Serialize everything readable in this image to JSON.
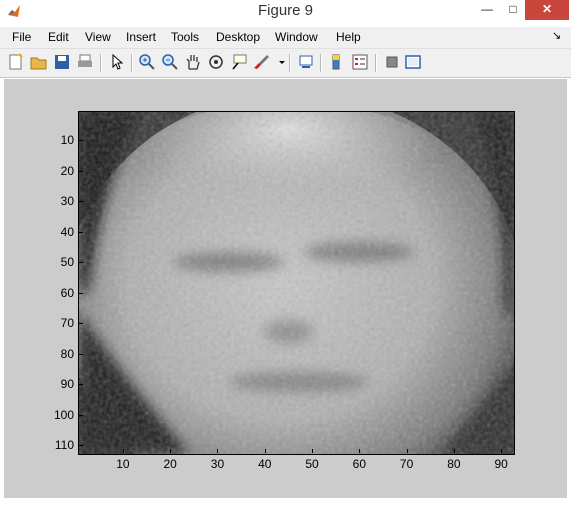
{
  "window": {
    "title": "Figure 9"
  },
  "menu": [
    "File",
    "Edit",
    "View",
    "Insert",
    "Tools",
    "Desktop",
    "Window",
    "Help"
  ],
  "toolbar_icons": [
    "new-figure-icon",
    "open-file-icon",
    "save-icon",
    "print-icon",
    "pointer-icon",
    "zoom-in-icon",
    "zoom-out-icon",
    "pan-icon",
    "rotate-3d-icon",
    "data-cursor-icon",
    "brush-icon",
    "brush-dropdown-icon",
    "link-plot-icon",
    "colorbar-icon",
    "legend-icon",
    "hide-plot-tools-icon",
    "show-plot-tools-icon"
  ],
  "axes": {
    "yticks": [
      "10",
      "20",
      "30",
      "40",
      "50",
      "60",
      "70",
      "80",
      "90",
      "100",
      "110"
    ],
    "xticks": [
      "10",
      "20",
      "30",
      "40",
      "50",
      "60",
      "70",
      "80",
      "90"
    ],
    "ylim": [
      0.5,
      112.5
    ],
    "xlim": [
      0.5,
      92.5
    ],
    "image": "grayscale-face"
  }
}
